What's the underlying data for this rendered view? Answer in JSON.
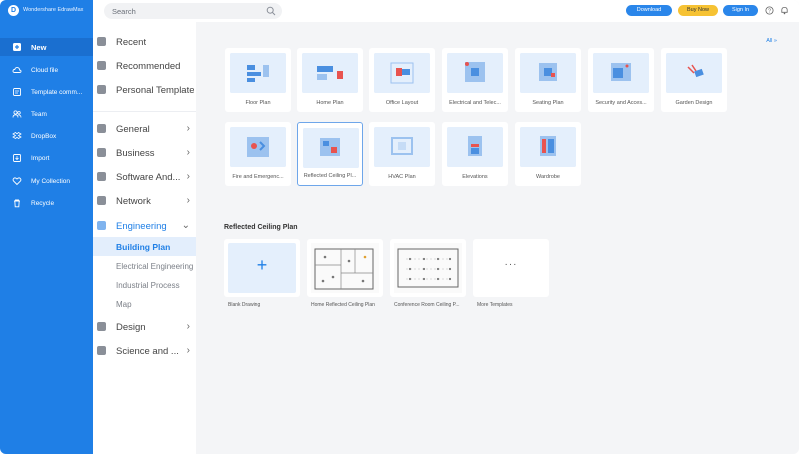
{
  "app": {
    "title": "Wondershare EdrawMax",
    "logo_letter": "D"
  },
  "search": {
    "placeholder": "Search"
  },
  "header": {
    "download": "Download",
    "buy_now": "Buy Now",
    "sign_in": "Sign In"
  },
  "nav": {
    "items": [
      {
        "label": "New",
        "icon": "plus-icon",
        "active": true
      },
      {
        "label": "Cloud file",
        "icon": "cloud-icon"
      },
      {
        "label": "Template comm...",
        "icon": "template-icon"
      },
      {
        "label": "Team",
        "icon": "team-icon"
      },
      {
        "label": "DropBox",
        "icon": "dropbox-icon"
      },
      {
        "label": "Import",
        "icon": "import-icon"
      },
      {
        "label": "My Collection",
        "icon": "heart-icon"
      },
      {
        "label": "Recycle",
        "icon": "trash-icon"
      }
    ]
  },
  "categories": {
    "top": [
      {
        "label": "Recent",
        "icon": "clock-icon"
      },
      {
        "label": "Recommended",
        "icon": "star-icon"
      },
      {
        "label": "Personal Templates",
        "icon": "user-template-icon"
      }
    ],
    "groups": [
      {
        "label": "General",
        "icon": "general-icon"
      },
      {
        "label": "Business",
        "icon": "business-icon"
      },
      {
        "label": "Software And...",
        "icon": "software-icon"
      },
      {
        "label": "Network",
        "icon": "network-icon"
      },
      {
        "label": "Engineering",
        "icon": "engineering-icon",
        "expanded": true
      }
    ],
    "sub": [
      {
        "label": "Building Plan",
        "active": true
      },
      {
        "label": "Electrical Engineering"
      },
      {
        "label": "Industrial Process"
      },
      {
        "label": "Map"
      }
    ],
    "more": [
      {
        "label": "Design",
        "icon": "design-icon"
      },
      {
        "label": "Science and ...",
        "icon": "science-icon"
      }
    ]
  },
  "main": {
    "all_link": "All »",
    "templates": [
      "Floor Plan",
      "Home Plan",
      "Office Layout",
      "Electrical and Telec...",
      "Seating Plan",
      "Security and Acces...",
      "Garden Design",
      "Fire and Emergenc...",
      "Reflected Ceiling Pl...",
      "HVAC Plan",
      "Elevations",
      "Wardrobe"
    ],
    "section_title": "Reflected Ceiling Plan",
    "cards": [
      {
        "label": "Blank Drawing",
        "kind": "blank"
      },
      {
        "label": "Home Reflected Ceiling Plan",
        "kind": "plan"
      },
      {
        "label": "Conference Room Ceiling P...",
        "kind": "plan"
      },
      {
        "label": "More Templates",
        "kind": "more"
      }
    ],
    "plus_symbol": "+",
    "more_symbol": "···"
  },
  "colors": {
    "accent": "#1f7fe6",
    "buy": "#f6c233",
    "thumb_bg": "#e4effc"
  }
}
